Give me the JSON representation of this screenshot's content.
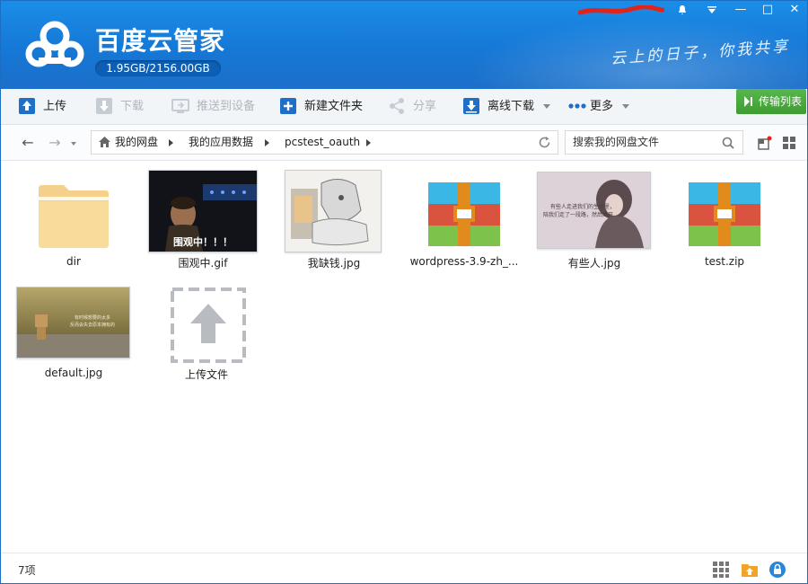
{
  "app": {
    "title": "百度云管家",
    "quota": "1.95GB/2156.00GB",
    "slogan": "云上的日子，你我共享"
  },
  "window": {
    "notify_icon": "bell-icon",
    "menu_icon": "dropdown-menu-icon",
    "min_label": "—",
    "max_label": "□",
    "close_label": "✕"
  },
  "toolbar": {
    "upload": "上传",
    "download": "下载",
    "push": "推送到设备",
    "new_folder": "新建文件夹",
    "share": "分享",
    "offline": "离线下载",
    "more": "更多",
    "transfer_list": "传输列表"
  },
  "nav": {
    "back": "←",
    "forward": "→",
    "crumbs": [
      "我的网盘",
      "我的应用数据",
      "pcstest_oauth"
    ],
    "search_placeholder": "搜索我的网盘文件"
  },
  "files": [
    {
      "name": "dir",
      "type": "folder"
    },
    {
      "name": "围观中.gif",
      "type": "image",
      "caption": "围观中！！！"
    },
    {
      "name": "我缺钱.jpg",
      "type": "image"
    },
    {
      "name": "wordpress-3.9-zh_...",
      "type": "archive"
    },
    {
      "name": "有些人.jpg",
      "type": "image",
      "caption": "有些人走进我们的生命里，\n陪我们走了一段路，然后离开……"
    },
    {
      "name": "test.zip",
      "type": "archive"
    },
    {
      "name": "default.jpg",
      "type": "image",
      "caption": "有时候想要的太多\n反而会失去原本拥有的"
    },
    {
      "name": "上传文件",
      "type": "upload"
    }
  ],
  "status": {
    "count": "7项"
  },
  "colors": {
    "header": "#1678d6",
    "accent_green": "#4aa83e",
    "zip_blue": "#3bb7e6",
    "zip_red": "#d9533f",
    "zip_green": "#7dc24a",
    "zip_orange": "#e08b1b"
  }
}
